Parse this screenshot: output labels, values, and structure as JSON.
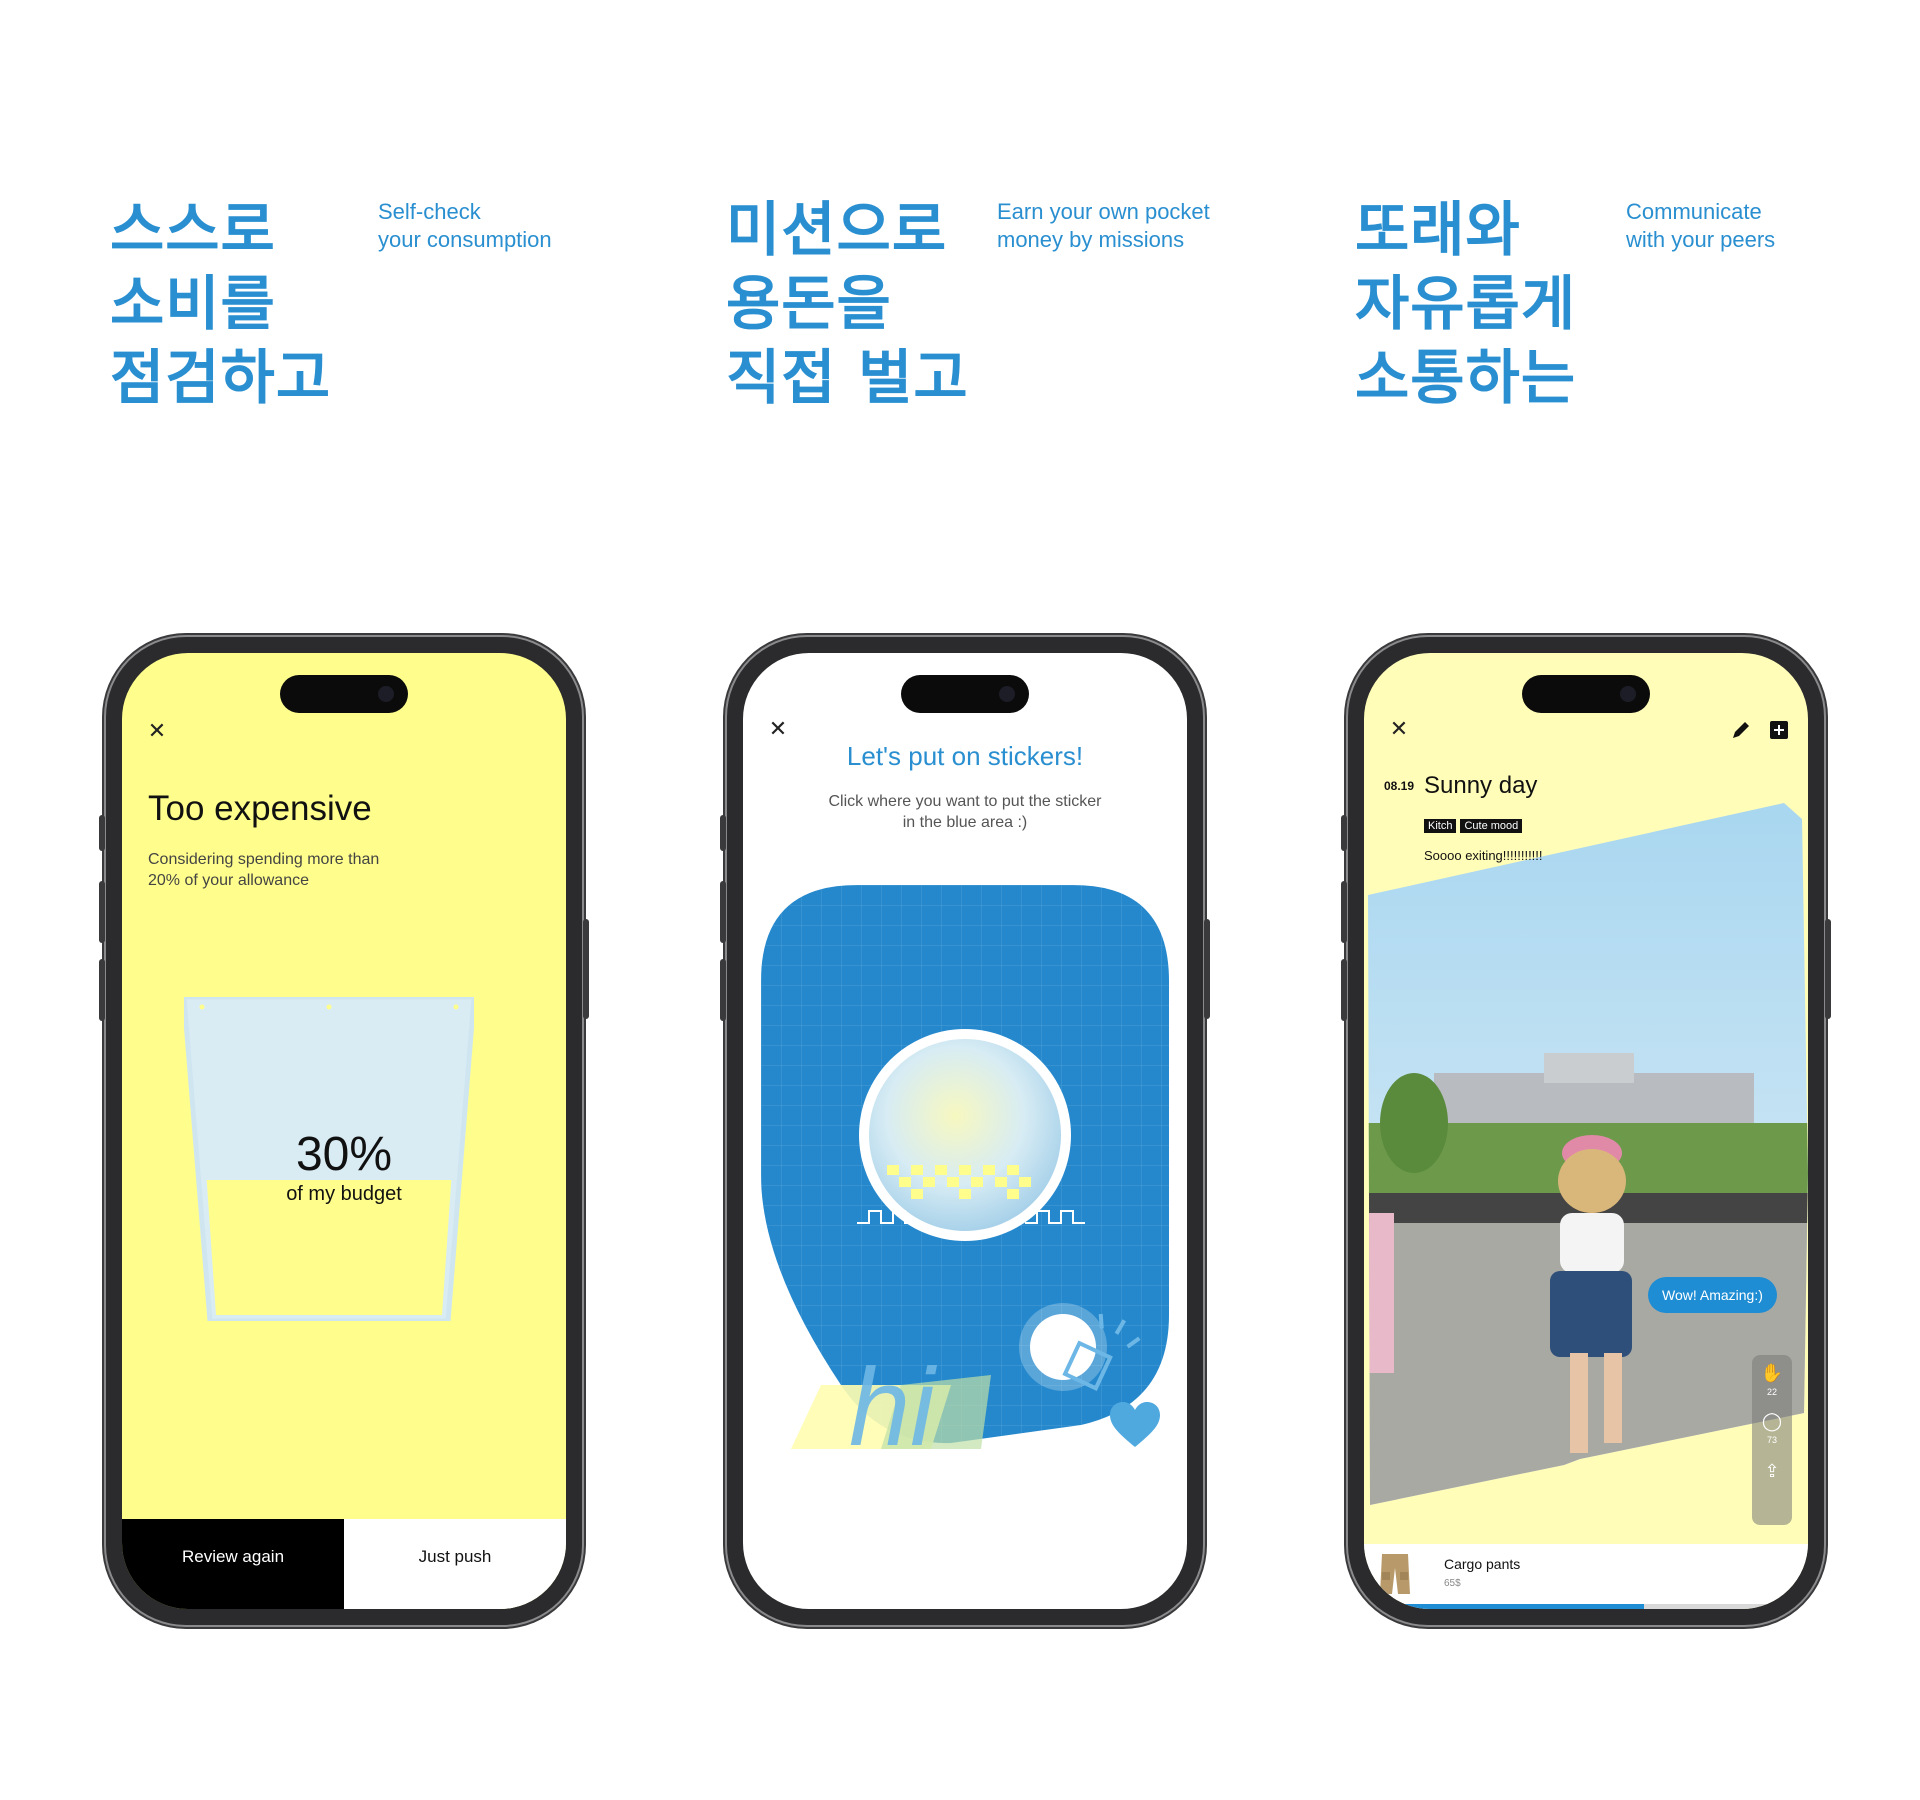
{
  "sections": [
    {
      "title_lines": [
        "스스로",
        "소비를",
        "점검하고"
      ],
      "subtitle_lines": [
        "Self-check",
        "your consumption"
      ]
    },
    {
      "title_lines": [
        "미션으로",
        "용돈을",
        "직접 벌고"
      ],
      "subtitle_lines": [
        "Earn your own pocket",
        "money by missions"
      ]
    },
    {
      "title_lines": [
        "또래와",
        "자유롭게",
        "소통하는"
      ],
      "subtitle_lines": [
        "Communicate",
        "with your peers"
      ]
    }
  ],
  "phone1": {
    "title": "Too expensive",
    "description_lines": [
      "Considering spending more than",
      "20% of your allowance"
    ],
    "budget_percent_label": "30%",
    "budget_fill_fraction": 0.3,
    "budget_caption": "of my budget",
    "buttons": {
      "review": "Review again",
      "push": "Just push"
    }
  },
  "phone2": {
    "title": "Let's put on stickers!",
    "instruction_lines": [
      "Click where you want to put the sticker",
      "in the blue area :)"
    ],
    "sticker_text": "hi"
  },
  "phone3": {
    "date": "08.19",
    "title": "Sunny day",
    "tags": [
      "Kitch",
      "Cute mood"
    ],
    "caption": "Soooo exiting!!!!!!!!!!!",
    "comment": "Wow! Amazing:)",
    "reactions": {
      "claps": "22",
      "comments": "73"
    },
    "product": {
      "name": "Cargo pants",
      "price": "65$"
    },
    "progress_fraction": 0.63
  },
  "colors": {
    "accent_blue": "#2a8fd0",
    "yellow": "#fffe8c",
    "light_yellow": "#fffdb8",
    "phone_frame": "#2b2b2d"
  }
}
